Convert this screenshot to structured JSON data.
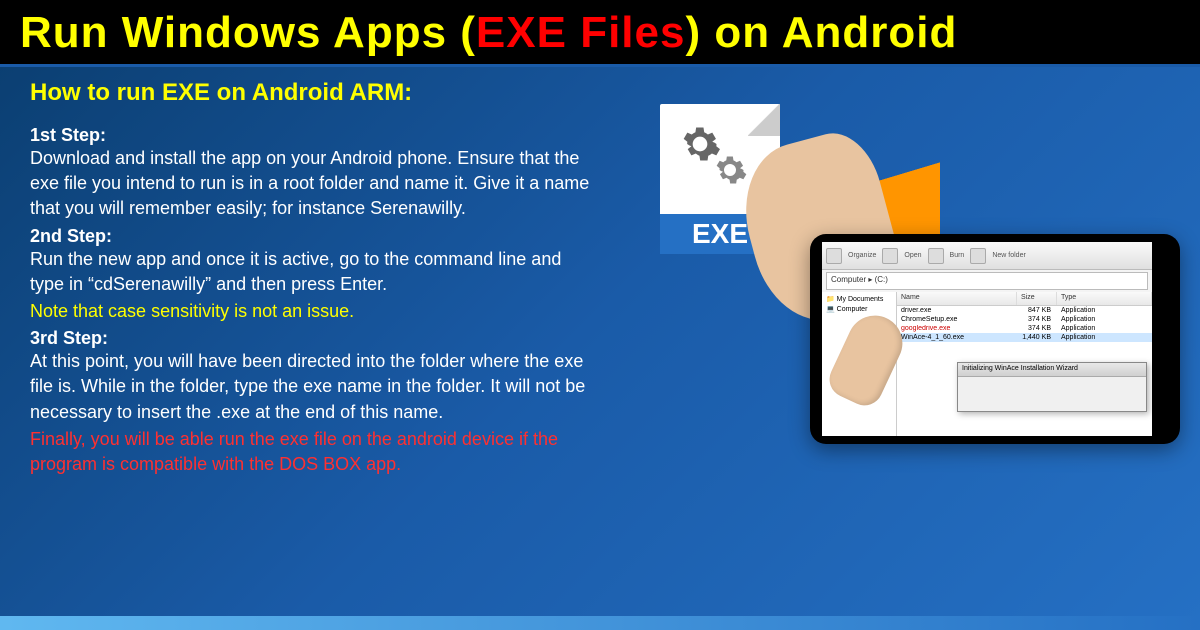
{
  "title": {
    "part1": "Run Windows Apps (",
    "part2": "EXE Files",
    "part3": ") on Android"
  },
  "subtitle": "How to run EXE on Android ARM:",
  "steps": {
    "s1": {
      "heading": "1st Step:",
      "text": "Download and install the app on your Android phone. Ensure that the exe file you intend to run is in a root folder and name it. Give it a name that you will remember easily; for instance Serenawilly."
    },
    "s2": {
      "heading": "2nd Step:",
      "text": "Run the new app and once it is active, go to the command line and type in “cdSerenawilly” and then press Enter.",
      "note": "Note that case sensitivity is not an issue."
    },
    "s3": {
      "heading": "3rd Step:",
      "text": "At this point, you will have been directed into the folder where the exe file is. While in the folder, type the exe name in the folder. It will not be necessary to insert the .exe at the end of this name.",
      "final": "Finally, you will be able run the exe file on the android device if the program is compatible with the DOS BOX app."
    }
  },
  "exe": {
    "label": "EXE"
  },
  "explorer": {
    "address": "Computer ▸ (C:)",
    "tree": [
      "My Documents",
      "Computer"
    ],
    "headers": {
      "name": "Name",
      "size": "Size",
      "type": "Type"
    },
    "rows": [
      {
        "name": "driver.exe",
        "size": "847 KB",
        "type": "Application"
      },
      {
        "name": "ChromeSetup.exe",
        "size": "374 KB",
        "type": "Application"
      },
      {
        "name": "googledrive.exe",
        "size": "374 KB",
        "type": "Application"
      },
      {
        "name": "WinAce-4_1_60.exe",
        "size": "1,440 KB",
        "type": "Application"
      }
    ],
    "dialog": {
      "title": "Initializing WinAce Installation Wizard",
      "body": ""
    },
    "toolbar": [
      "Organize",
      "Open",
      "Burn",
      "New folder"
    ]
  }
}
